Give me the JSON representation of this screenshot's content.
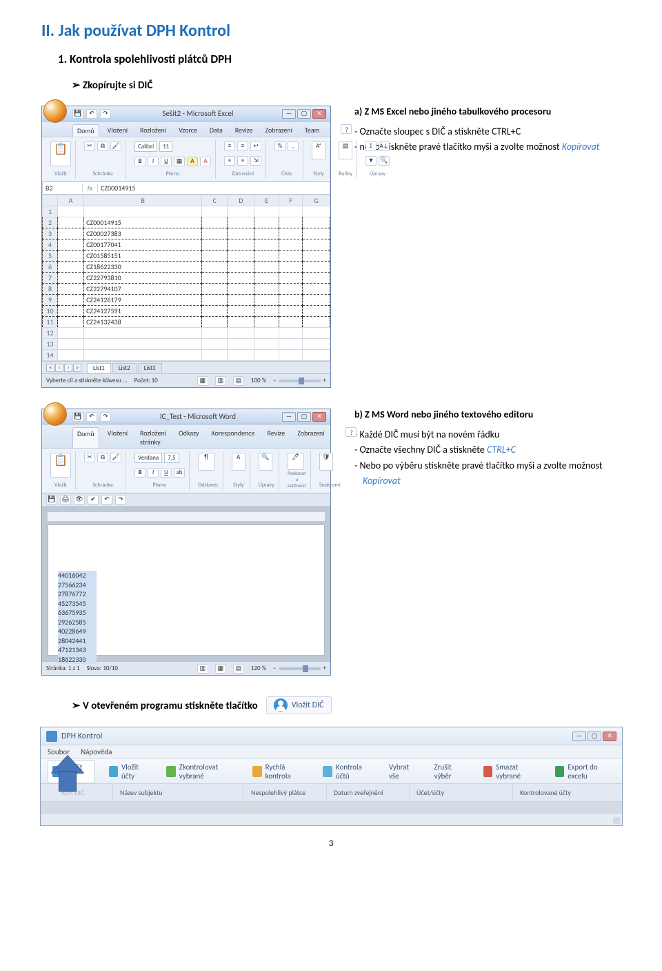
{
  "headings": {
    "h1": "II.   Jak používat DPH Kontrol",
    "h2": "1. Kontrola spolehlivosti plátců DPH",
    "h3a": "Zkopírujte si DIČ",
    "h3b": "V otevřeném programu stiskněte tlačítko"
  },
  "step_a": {
    "title": "a)   Z MS Excel nebo jiného tabulkového procesoru",
    "bullets": [
      "Označte sloupec s DIČ a stiskněte CTRL+C",
      "nebo stiskněte pravé tlačítko myši a zvolte možnost "
    ],
    "kopirovat": "Kopírovat"
  },
  "step_b": {
    "title": "b)   Z MS Word nebo jiného textového editoru",
    "bullets": [
      "Každé DIČ musí být na novém řádku",
      "Označte všechny DIČ a stiskněte ",
      "Nebo po výběru stiskněte pravé tlačítko myši a zvolte možnost "
    ],
    "ctrlc": "CTRL+C",
    "kopirovat": "Kopírovat"
  },
  "excel": {
    "title": "Sešit2 - Microsoft Excel",
    "tabs": [
      "Domů",
      "Vložení",
      "Rozložení",
      "Vzorce",
      "Data",
      "Revize",
      "Zobrazení",
      "Team"
    ],
    "groups": {
      "clipboard": "Schránka",
      "font": "Písmo",
      "align": "Zarovnání",
      "number": "Číslo",
      "styles": "Styly",
      "cells": "Buňky",
      "edit": "Úpravy",
      "paste": "Vložit"
    },
    "font_name": "Calibri",
    "font_size": "11",
    "namebox": "B2",
    "formula": "CZ00014915",
    "cols": [
      "A",
      "B",
      "C",
      "D",
      "E",
      "F",
      "G"
    ],
    "rows": [
      "1",
      "2",
      "3",
      "4",
      "5",
      "6",
      "7",
      "8",
      "9",
      "10",
      "11",
      "12",
      "13",
      "14"
    ],
    "data": [
      "",
      "CZ00014915",
      "CZ00027383",
      "CZ00177041",
      "CZ01585151",
      "CZ18622330",
      "CZ22793810",
      "CZ22794107",
      "CZ24126179",
      "CZ24127591",
      "CZ24132438"
    ],
    "sheet_tabs": [
      "List1",
      "List2",
      "List3"
    ],
    "status_left": "Vyberte cíl a stiskněte klávesu ...",
    "status_count": "Počet: 10",
    "zoom": "100 %"
  },
  "word": {
    "title": "IC_Test - Microsoft Word",
    "tabs": [
      "Domů",
      "Vložení",
      "Rozložení stránky",
      "Odkazy",
      "Korespondence",
      "Revize",
      "Zobrazení"
    ],
    "groups": {
      "clipboard": "Schránka",
      "font": "Písmo",
      "para": "Odstavec",
      "styles": "Styly",
      "edit": "Úpravy",
      "protect": "Podepsat a zašifrovat",
      "privacy": "Soukromí",
      "paste": "Vložit"
    },
    "font_name": "Verdana",
    "font_size": "7,5",
    "lines": [
      "44016042",
      "27566234",
      "27876772",
      "45273545",
      "63675935",
      "29262585",
      "40228649",
      "28042441",
      "47121343",
      "18622330"
    ],
    "status_page": "Stránka: 1 z 1",
    "status_words": "Slova: 10/10",
    "zoom": "120 %"
  },
  "vlozit_button": "Vložit DIČ",
  "dph": {
    "title": "DPH Kontrol",
    "menu": [
      "Soubor",
      "Nápověda"
    ],
    "toolbar": [
      "Vložit DIČ",
      "Vložit účty",
      "Zkontrolovat vybrané",
      "Rychlá kontrola",
      "Kontrola účtů",
      "Vybrat vše",
      "Zrušit výběr",
      "Smazat vybrané",
      "Export do excelu"
    ],
    "toolbar_first_small": "ložit DIČ",
    "cols": [
      "",
      "Název subjektu",
      "Nespolehlivý plátce",
      "Datum zveřejnění",
      "Účet/účty",
      "Kontrolované účty"
    ]
  },
  "page_number": "3"
}
